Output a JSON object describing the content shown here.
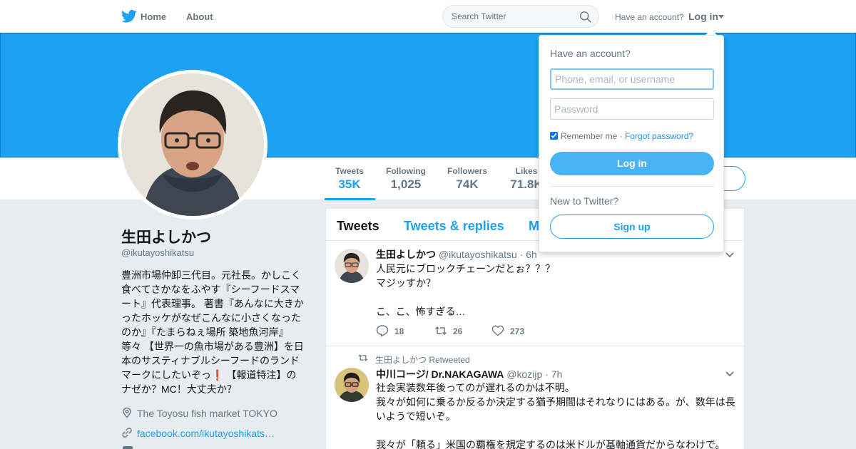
{
  "nav": {
    "home_label": "Home",
    "about_label": "About",
    "search_placeholder": "Search Twitter",
    "have_account": "Have an account?",
    "login_label": "Log in"
  },
  "profile": {
    "name": "生田よしかつ",
    "handle": "@ikutayoshikatsu",
    "bio_lines": [
      "豊洲市場仲卸三代目。元社長。かしこく",
      "食べてさかなをふやす『シーフードスマ",
      "ート』代表理事。 著書『あんなに大きか",
      "ったホッケがなぜこんなに小さくなった",
      "のか』『たまらねぇ場所 築地魚河岸』",
      "等々 【世界一の魚市場がある豊洲】を日",
      "本のサスティナブルシーフードのランド",
      "マークにしたいぞっ❗️ 【報道特注】の",
      "ナゼか？MC！大丈夫か？"
    ],
    "location": "The Toyosu fish market TOKYO",
    "website": "facebook.com/ikutayoshikats…"
  },
  "stats": [
    {
      "label": "Tweets",
      "value": "35K"
    },
    {
      "label": "Following",
      "value": "1,025"
    },
    {
      "label": "Followers",
      "value": "74K"
    },
    {
      "label": "Likes",
      "value": "71.8K"
    }
  ],
  "tabs": {
    "tweets": "Tweets",
    "replies": "Tweets & replies",
    "media": "M"
  },
  "tweets": [
    {
      "name": "生田よしかつ",
      "handle": "@ikutayoshikatsu",
      "time": "· 6h",
      "lines": [
        "人民元にブロックチェーンだとぉ？？？",
        "マジッすか？",
        "",
        "こ、こ、怖すぎる…"
      ],
      "replies": "18",
      "retweets": "26",
      "likes": "273"
    },
    {
      "context": "生田よしかつ Retweeted",
      "name": "中川コージ/ Dr.NAKAGAWA",
      "handle": "@kozijp",
      "time": "· 7h",
      "lines": [
        "社会実装数年後ってのが遅れるのかは不明。",
        "我々が如何に乗るか反るか決定する猶予期間はそれなりにはある。が、数年は長",
        "いようで短いぞ。",
        "",
        "我々が「頼る」米国の覇権を規定するのは米ドルが基軸通貨だからなわけで。"
      ]
    }
  ],
  "login_dropdown": {
    "title": "Have an account?",
    "username_placeholder": "Phone, email, or username",
    "password_placeholder": "Password",
    "remember_label": "Remember me",
    "separator": " · ",
    "forgot_label": "Forgot password?",
    "login_button": "Log in",
    "new_to": "New to Twitter?",
    "signup_button": "Sign up"
  },
  "colors": {
    "brand": "#1da1f2",
    "background": "#e6ecf0",
    "muted_text": "#657786"
  }
}
